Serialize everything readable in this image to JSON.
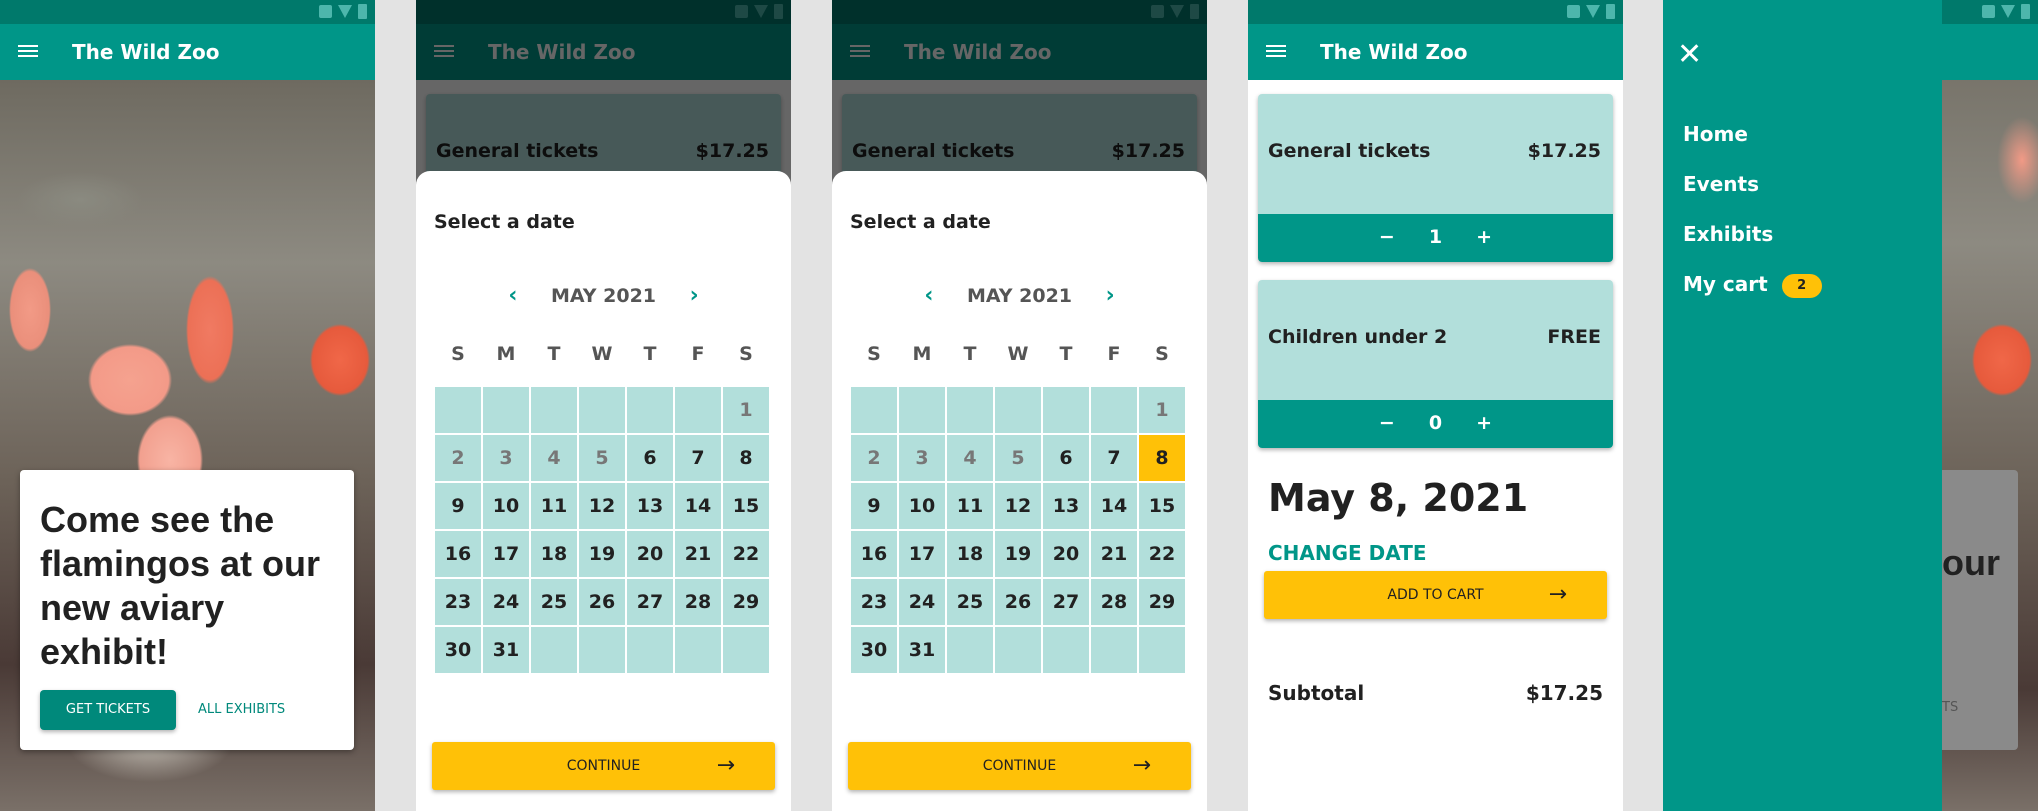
{
  "app": {
    "title": "The Wild Zoo"
  },
  "hero": {
    "heading": "Come see the flamingos at our new aviary exhibit!",
    "primary_button": "GET TICKETS",
    "secondary_button": "ALL EXHIBITS"
  },
  "tickets": {
    "general": {
      "name": "General tickets",
      "price": "$17.25",
      "qty": "1"
    },
    "children": {
      "name": "Children under 2",
      "price": "FREE",
      "qty": "0"
    }
  },
  "stepper": {
    "minus": "−",
    "plus": "+"
  },
  "date_picker": {
    "title": "Select a date",
    "month": "MAY 2021",
    "weekdays": [
      "S",
      "M",
      "T",
      "W",
      "T",
      "F",
      "S"
    ],
    "continue": "CONTINUE",
    "selected_day": 8,
    "first_available": 6
  },
  "cart": {
    "date": "May 8, 2021",
    "change_date": "CHANGE DATE",
    "subtotal_label": "Subtotal",
    "subtotal_value": "$17.25",
    "add_to_cart": "ADD TO CART"
  },
  "drawer": {
    "items": [
      {
        "label": "Home"
      },
      {
        "label": "Events"
      },
      {
        "label": "Exhibits"
      },
      {
        "label": "My cart",
        "badge": "2"
      }
    ]
  },
  "behind": {
    "fragment_text": "our",
    "fragment_link": "TS"
  },
  "colors": {
    "teal": "#009688",
    "dark_teal": "#00796b",
    "light_teal": "#b2dfdb",
    "amber": "#ffc107"
  },
  "icons": {
    "menu": "menu-icon",
    "close": "close-icon",
    "prev": "chevron-left-icon",
    "next": "chevron-right-icon",
    "arrow": "arrow-right-icon"
  }
}
